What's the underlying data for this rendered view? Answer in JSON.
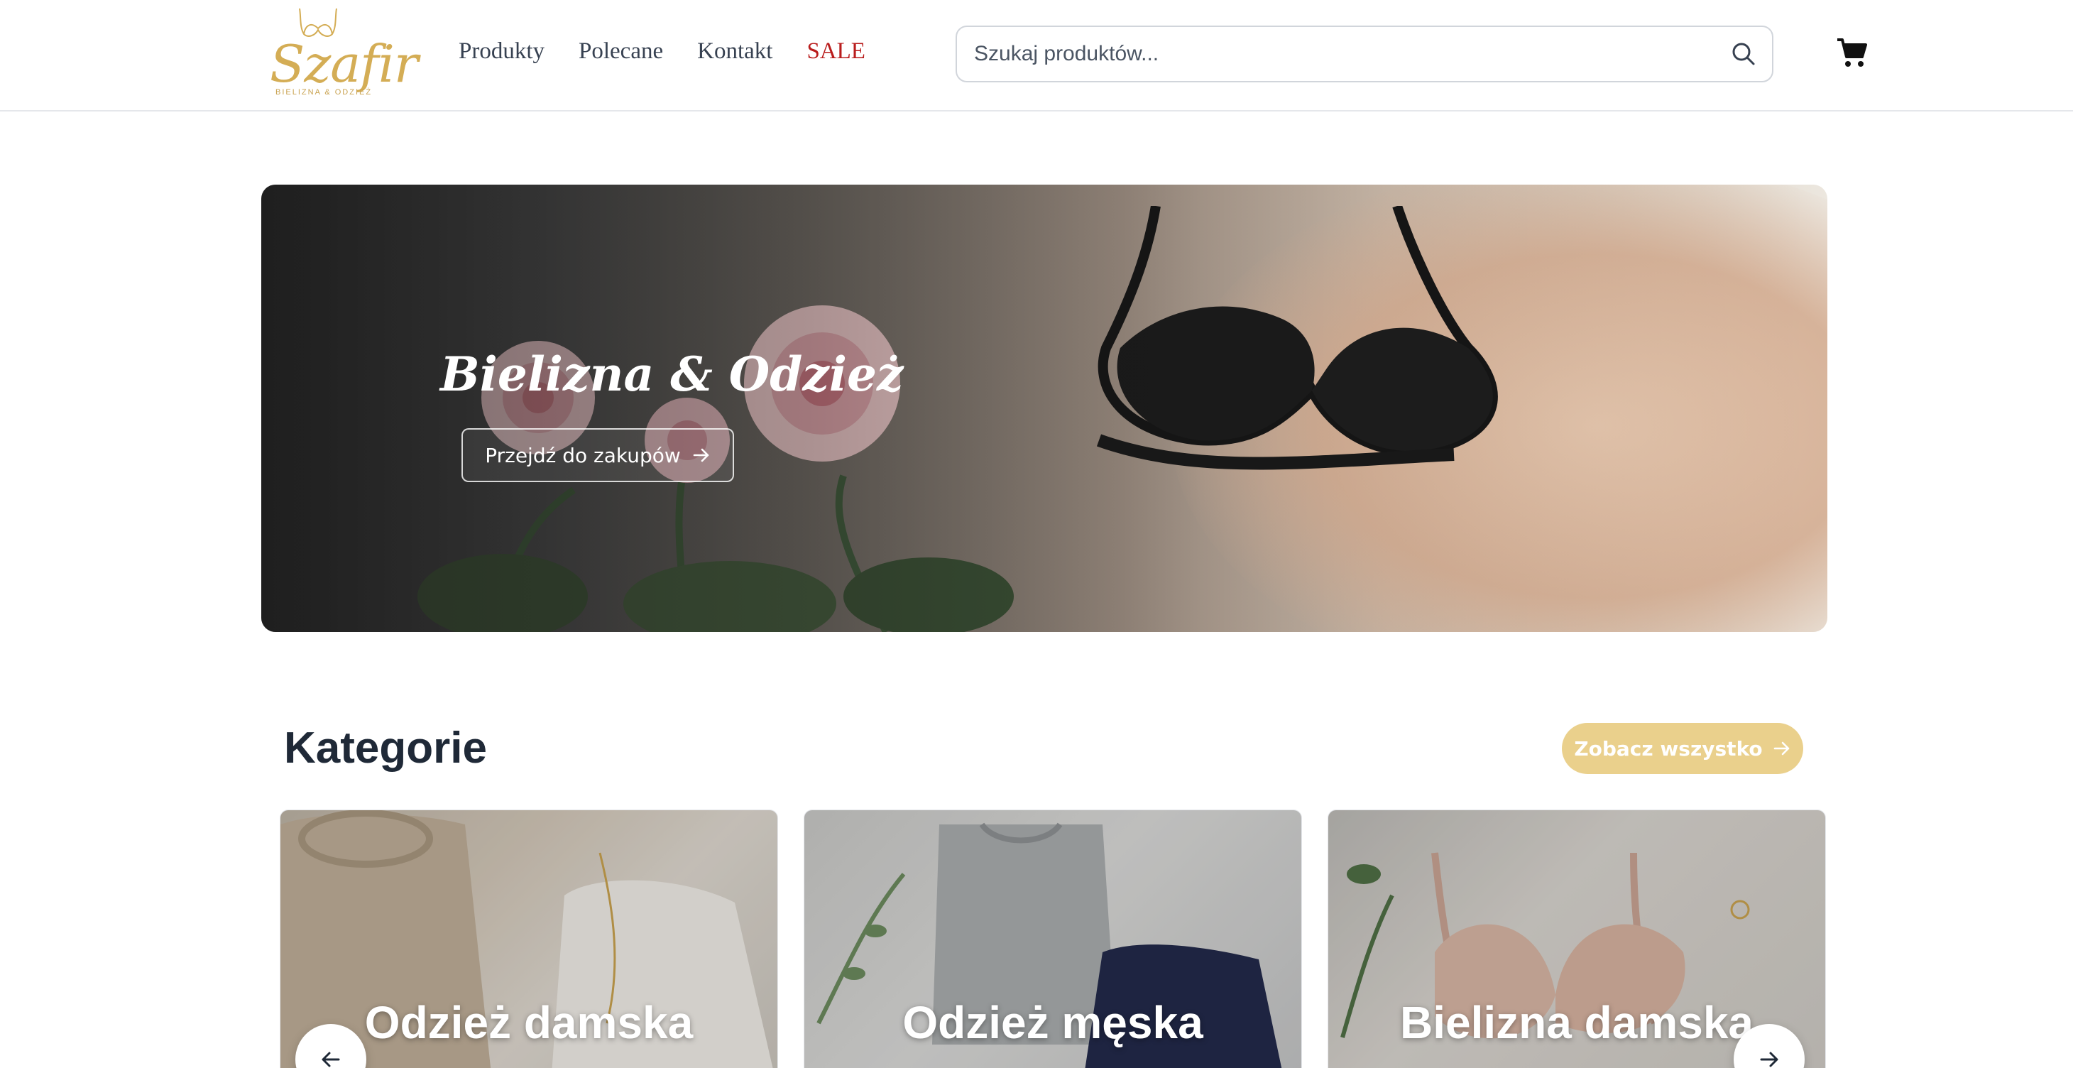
{
  "brand": {
    "name": "Szafir",
    "tagline": "BIELIZNA & ODZIEŻ",
    "gold": "#d4ad55"
  },
  "nav": {
    "items": [
      {
        "label": "Produkty"
      },
      {
        "label": "Polecane"
      },
      {
        "label": "Kontakt"
      },
      {
        "label": "SALE",
        "color": "#b91c1c"
      }
    ]
  },
  "search": {
    "placeholder": "Szukaj produktów...",
    "value": "",
    "icon": "search-icon"
  },
  "cart": {
    "icon": "cart-icon"
  },
  "hero": {
    "title": "Bielizna & Odzież",
    "cta_label": "Przejdź do zakupów",
    "cta_icon": "arrow-right-icon"
  },
  "categories": {
    "title": "Kategorie",
    "see_all_label": "Zobacz wszystko",
    "see_all_color": "#ead08c",
    "items": [
      {
        "label": "Odzież damska"
      },
      {
        "label": "Odzież męska"
      },
      {
        "label": "Bielizna damska"
      }
    ],
    "prev_icon": "arrow-left-icon",
    "next_icon": "arrow-right-icon"
  }
}
